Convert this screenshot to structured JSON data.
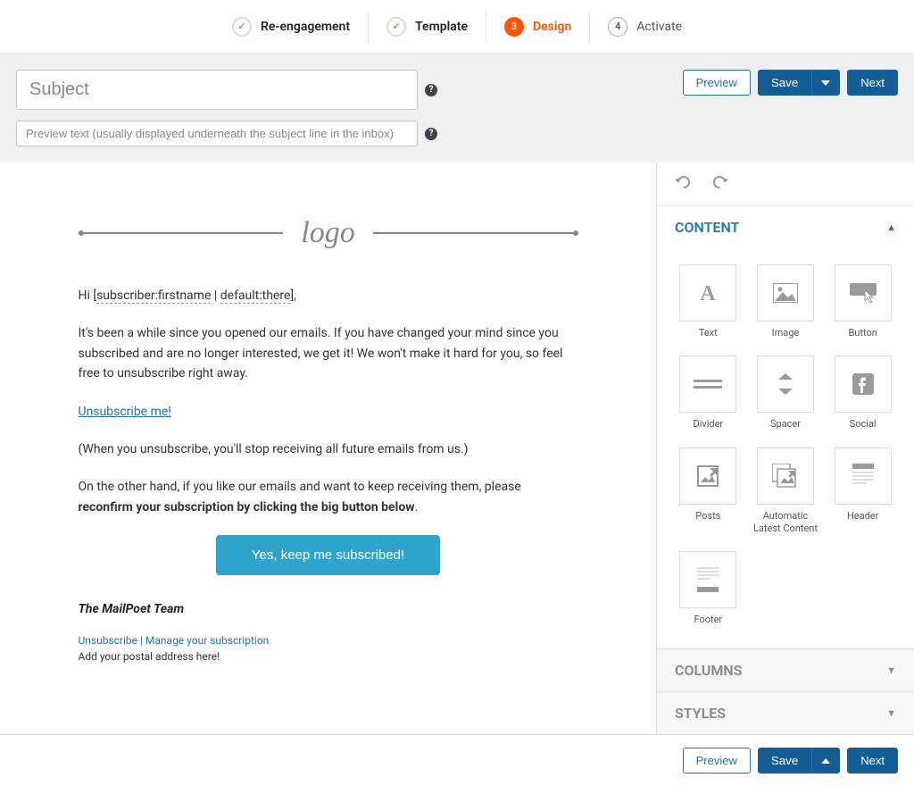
{
  "stepper": {
    "steps": [
      {
        "label": "Re-engagement",
        "state": "done"
      },
      {
        "label": "Template",
        "state": "done"
      },
      {
        "label": "Design",
        "num": "3",
        "state": "active"
      },
      {
        "label": "Activate",
        "num": "4",
        "state": "pending"
      }
    ]
  },
  "subject": {
    "placeholder": "Subject",
    "value": "",
    "preview_placeholder": "Preview text (usually displayed underneath the subject line in the inbox)",
    "preview_value": ""
  },
  "actions": {
    "preview": "Preview",
    "save": "Save",
    "next": "Next"
  },
  "email": {
    "logo": "logo",
    "greeting_prefix": "Hi [",
    "token1": "subscriber:firstname",
    "token_sep": " | ",
    "token2": "default:there",
    "greeting_suffix": "],",
    "p1": "It's been a while since you opened our emails. If you have changed your mind since you subscribed and are no longer interested, we get it! We won't make it hard for you, so feel free to unsubscribe right away.",
    "unsubscribe_link": "Unsubscribe me!",
    "p2": "(When you unsubscribe, you'll stop receiving all future emails from us.)",
    "p3a": "On the other hand, if you like our emails and want to keep receiving them, please ",
    "p3b": "reconfirm your subscription by clicking the big button below",
    "p3c": ".",
    "cta": "Yes, keep me subscribed!",
    "signature": "The MailPoet Team",
    "footer_unsub": "Unsubscribe",
    "footer_sep": " | ",
    "footer_manage": "Manage your subscription",
    "footer_addr": "Add your postal address here!"
  },
  "sidebar": {
    "content": "CONTENT",
    "columns": "COLUMNS",
    "styles": "STYLES",
    "widgets": {
      "text": "Text",
      "image": "Image",
      "button": "Button",
      "divider": "Divider",
      "spacer": "Spacer",
      "social": "Social",
      "posts": "Posts",
      "alc": "Automatic Latest Content",
      "header": "Header",
      "footer": "Footer"
    }
  }
}
